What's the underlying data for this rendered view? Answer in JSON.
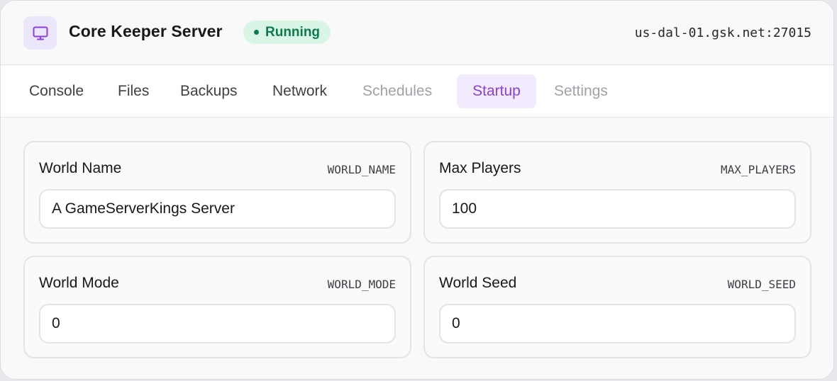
{
  "header": {
    "title": "Core Keeper Server",
    "status": "Running",
    "status_color": "#0f7a4d",
    "address": "us-dal-01.gsk.net:27015",
    "icon": "monitor-icon"
  },
  "tabs": [
    {
      "label": "Console",
      "state": "enabled"
    },
    {
      "label": "Files",
      "state": "enabled"
    },
    {
      "label": "Backups",
      "state": "enabled"
    },
    {
      "label": "Network",
      "state": "enabled"
    },
    {
      "label": "Schedules",
      "state": "disabled"
    },
    {
      "label": "Startup",
      "state": "active"
    },
    {
      "label": "Settings",
      "state": "disabled"
    }
  ],
  "accent_color": "#8b3fe0",
  "variables": [
    {
      "label": "World Name",
      "var": "WORLD_NAME",
      "value": "A GameServerKings Server"
    },
    {
      "label": "Max Players",
      "var": "MAX_PLAYERS",
      "value": "100"
    },
    {
      "label": "World Mode",
      "var": "WORLD_MODE",
      "value": "0"
    },
    {
      "label": "World Seed",
      "var": "WORLD_SEED",
      "value": "0"
    }
  ]
}
